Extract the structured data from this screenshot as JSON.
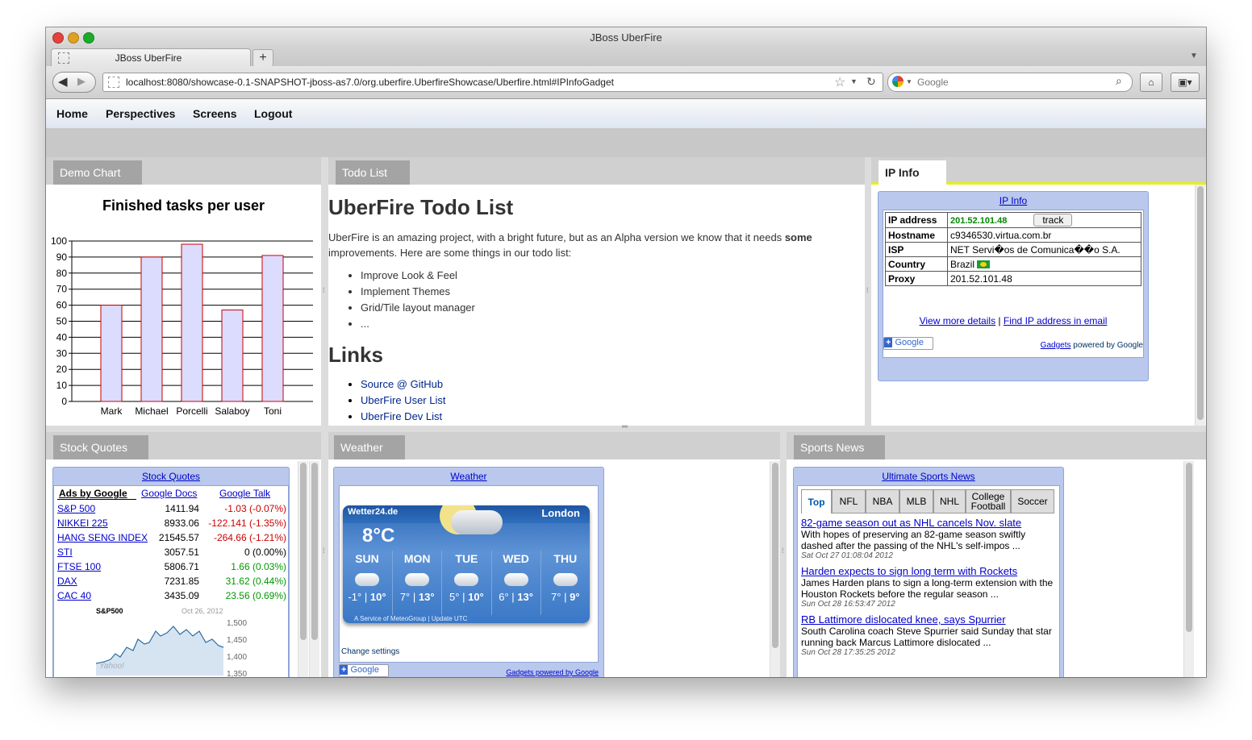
{
  "browser": {
    "window_title": "JBoss UberFire",
    "tab_title": "JBoss UberFire",
    "new_tab": "+",
    "url": "localhost:8080/showcase-0.1-SNAPSHOT-jboss-as7.0/org.uberfire.UberfireShowcase/Uberfire.html#IPInfoGadget",
    "search_placeholder": "Google",
    "icons": [
      "back-icon",
      "forward-icon",
      "star-icon",
      "reload-icon",
      "search-icon",
      "home-icon",
      "bookmark-icon"
    ]
  },
  "menu": {
    "items": [
      "Home",
      "Perspectives",
      "Screens",
      "Logout"
    ]
  },
  "demo_chart": {
    "tab": "Demo Chart",
    "title": "Finished tasks per user"
  },
  "chart_data": {
    "type": "bar",
    "title": "Finished tasks per user",
    "categories": [
      "Mark",
      "Michael",
      "Porcelli",
      "Salaboy",
      "Toni"
    ],
    "values": [
      60,
      90,
      98,
      57,
      91
    ],
    "ylim": [
      0,
      100
    ],
    "yticks": [
      "0",
      "10",
      "20",
      "30",
      "40",
      "50",
      "60",
      "70",
      "80",
      "90",
      "100"
    ],
    "bar_fill": "#dcdcff",
    "bar_stroke": "#cc0000",
    "grid": true
  },
  "todo": {
    "tab": "Todo List",
    "heading": "UberFire Todo List",
    "intro_a": "UberFire is an amazing project, with a bright future, but as an Alpha version we know that it needs ",
    "intro_bold": "some",
    "intro_b": "improvements. Here are some things in our todo list:",
    "items": [
      "Improve Look & Feel",
      "Implement Themes",
      "Grid/Tile layout manager",
      "..."
    ],
    "links_heading": "Links",
    "links": [
      "Source @ GitHub",
      "UberFire User List",
      "UberFire Dev List"
    ]
  },
  "ipinfo": {
    "tab": "IP Info",
    "gadget_title": "IP Info",
    "rows": [
      {
        "label": "IP address",
        "value": "201.52.101.48",
        "button": "track"
      },
      {
        "label": "Hostname",
        "value": "c9346530.virtua.com.br"
      },
      {
        "label": "ISP",
        "value": "NET Servi�os de Comunica��o S.A."
      },
      {
        "label": "Country",
        "value": "Brazil"
      },
      {
        "label": "Proxy",
        "value": "201.52.101.48"
      }
    ],
    "link1": "View more details",
    "sep": "|",
    "link2": "Find IP address in email",
    "google_btn": "Google",
    "footer_link": "Gadgets",
    "footer_text": "powered by Google"
  },
  "stocks": {
    "tab": "Stock Quotes",
    "gadget_title": "Stock Quotes",
    "header_links": [
      "Ads by Google",
      "Google Docs",
      "Google Talk"
    ],
    "rows": [
      {
        "name": "S&P 500",
        "price": "1411.94",
        "change": "-1.03 (-0.07%)",
        "dir": "neg"
      },
      {
        "name": "NIKKEI 225",
        "price": "8933.06",
        "change": "-122.141 (-1.35%)",
        "dir": "neg"
      },
      {
        "name": "HANG SENG INDEX",
        "price": "21545.57",
        "change": "-264.66 (-1.21%)",
        "dir": "neg"
      },
      {
        "name": "STI",
        "price": "3057.51",
        "change": "0  (0.00%)",
        "dir": "zero"
      },
      {
        "name": "FTSE 100",
        "price": "5806.71",
        "change": "1.66  (0.03%)",
        "dir": "pos"
      },
      {
        "name": "DAX",
        "price": "7231.85",
        "change": "31.62  (0.44%)",
        "dir": "pos"
      },
      {
        "name": "CAC 40",
        "price": "3435.09",
        "change": "23.56  (0.69%)",
        "dir": "pos"
      }
    ],
    "mini_chart": {
      "label": "S&P500",
      "date": "Oct 26, 2012",
      "yticks": [
        "1,500",
        "1,450",
        "1,400",
        "1,350"
      ],
      "watermark": "Yahoo!"
    }
  },
  "weather": {
    "tab": "Weather",
    "gadget_title": "Weather",
    "brand": "Wetter24.de",
    "city": "London",
    "temp": "8°C",
    "days": [
      {
        "day": "SUN",
        "lo": "-1°",
        "hi": "10°"
      },
      {
        "day": "MON",
        "lo": "7°",
        "hi": "13°"
      },
      {
        "day": "TUE",
        "lo": "5°",
        "hi": "10°"
      },
      {
        "day": "WED",
        "lo": "6°",
        "hi": "13°"
      },
      {
        "day": "THU",
        "lo": "7°",
        "hi": "9°"
      }
    ],
    "sep": "|",
    "credit": "A Service of MeteoGroup | Update UTC",
    "change_settings": "Change settings",
    "google_btn": "Google",
    "footer": "Gadgets powered by Google"
  },
  "sports": {
    "tab": "Sports News",
    "gadget_title": "Ultimate Sports News",
    "tabs": [
      "Top",
      "NFL",
      "NBA",
      "MLB",
      "NHL",
      "College Football",
      "Soccer"
    ],
    "news": [
      {
        "headline": "82-game season out as NHL cancels Nov. slate",
        "summary": "With hopes of preserving an 82-game season swiftly dashed after the passing of the NHL's self-impos ...",
        "date": "Sat Oct 27 01:08:04 2012"
      },
      {
        "headline": "Harden expects to sign long term with Rockets",
        "summary": "James Harden plans to sign a long-term extension with the Houston Rockets before the regular season ...",
        "date": "Sun Oct 28 16:53:47 2012"
      },
      {
        "headline": "RB Lattimore dislocated knee, says Spurrier",
        "summary": "South Carolina coach Steve Spurrier said Sunday that star running back Marcus Lattimore dislocated ...",
        "date": "Sun Oct 28 17:35:25 2012"
      }
    ]
  },
  "colors": {
    "gadget_frame": "#b9c8ec",
    "link": "#0000cc",
    "negative": "#cc0000",
    "positive": "#009900",
    "weather_blue": "#2e6fbd",
    "active_tab_accent": "#e6ef1e"
  }
}
